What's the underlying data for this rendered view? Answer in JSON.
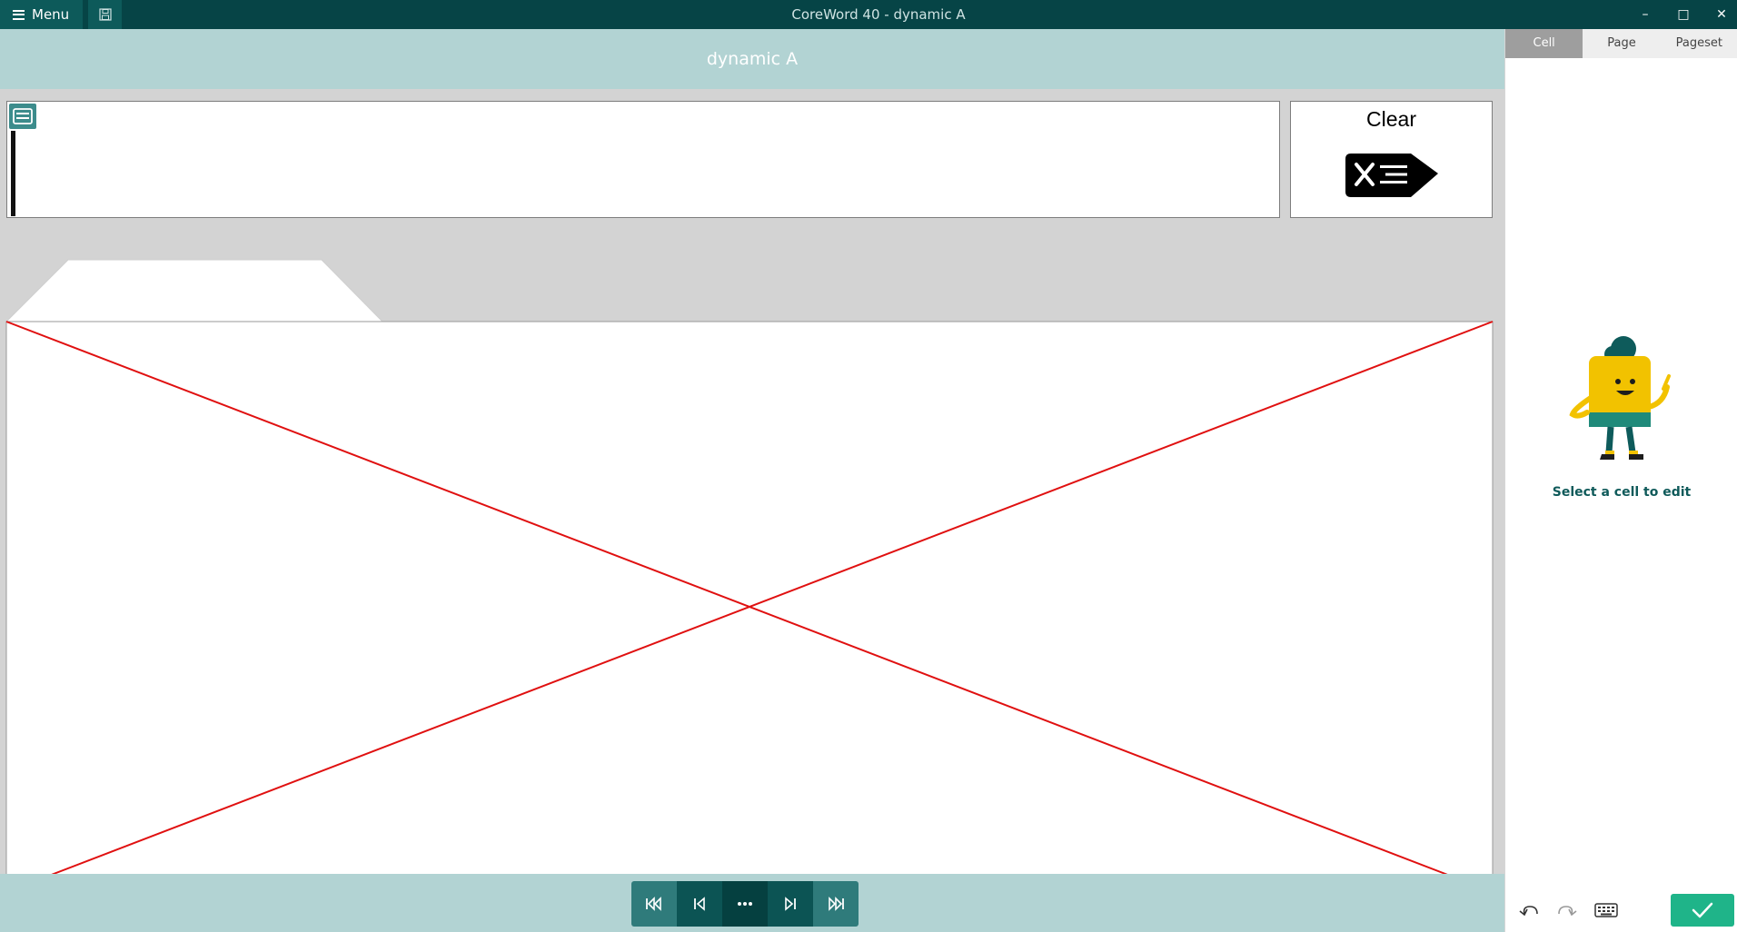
{
  "titlebar": {
    "menu_label": "Menu",
    "window_title": "CoreWord 40 - dynamic A",
    "minimize": "–",
    "maximize": "□",
    "close": "✕"
  },
  "page": {
    "title": "dynamic A"
  },
  "clear_cell": {
    "label": "Clear"
  },
  "right_panel": {
    "tabs": [
      "Cell",
      "Page",
      "Pageset"
    ],
    "active_tab": "Cell",
    "hint": "Select a cell to edit"
  },
  "colors": {
    "titlebar": "#064446",
    "header": "#b2d3d3",
    "accent": "#0c5454",
    "confirm": "#1fb489",
    "placeholder_cross": "#e01010"
  }
}
